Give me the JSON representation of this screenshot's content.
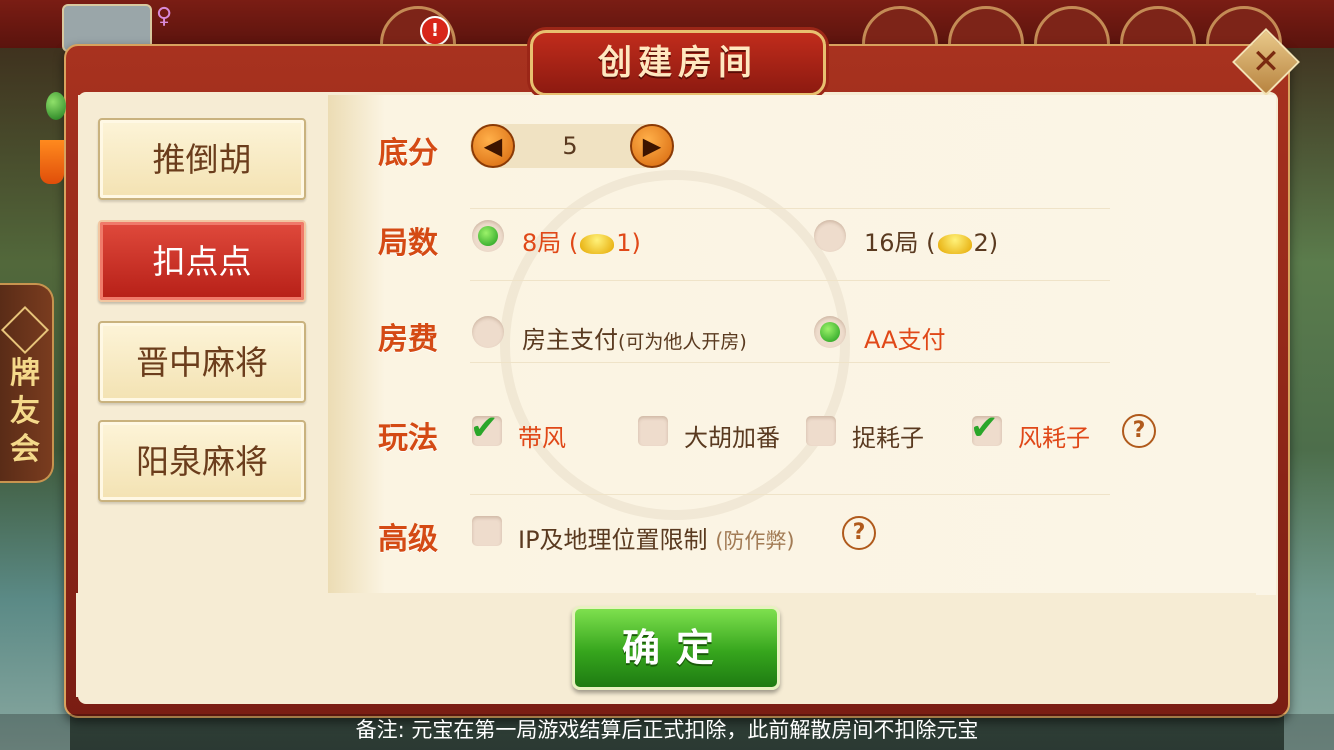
{
  "dialog": {
    "title": "创建房间",
    "close_icon": "close-icon"
  },
  "top": {
    "badge": "!"
  },
  "club": {
    "label": "牌友会"
  },
  "games": [
    {
      "label": "推倒胡",
      "active": false
    },
    {
      "label": "扣点点",
      "active": true
    },
    {
      "label": "晋中麻将",
      "active": false
    },
    {
      "label": "阳泉麻将",
      "active": false
    }
  ],
  "base_score": {
    "label": "底分",
    "value": "5"
  },
  "rounds": {
    "label": "局数",
    "options": [
      {
        "text": "8局 (",
        "cost": "1)",
        "selected": true
      },
      {
        "text": "16局 (",
        "cost": "2)",
        "selected": false
      }
    ]
  },
  "fee": {
    "label": "房费",
    "options": [
      {
        "text": "房主支付",
        "sub": "(可为他人开房)",
        "selected": false
      },
      {
        "text": "AA支付",
        "selected": true
      }
    ]
  },
  "rules": {
    "label": "玩法",
    "options": [
      {
        "text": "带风",
        "checked": true
      },
      {
        "text": "大胡加番",
        "checked": false
      },
      {
        "text": "捉耗子",
        "checked": false
      },
      {
        "text": "风耗子",
        "checked": true
      }
    ],
    "help": "?"
  },
  "advanced": {
    "label": "高级",
    "option": "IP及地理位置限制",
    "hint": "(防作弊)",
    "help": "?",
    "checked": false
  },
  "confirm": {
    "label": "确定"
  },
  "note": "备注: 元宝在第一局游戏结算后正式扣除，此前解散房间不扣除元宝",
  "colors": {
    "accent": "#d44a14",
    "selected_text": "#e04818",
    "confirm": "#36a51d",
    "active_tab": "#c8281c"
  }
}
